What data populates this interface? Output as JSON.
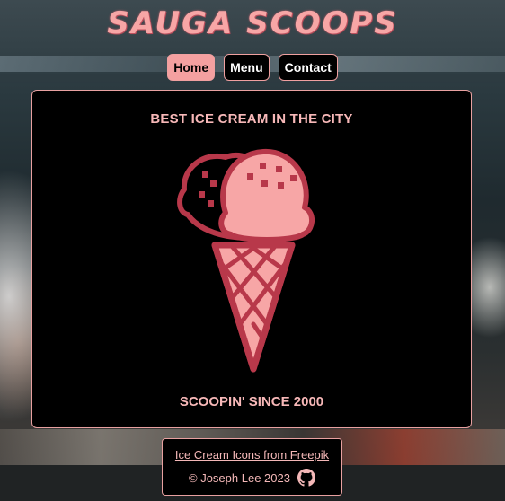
{
  "site": {
    "logo": "SAUGA SCOOPS"
  },
  "nav": {
    "items": [
      {
        "label": "Home",
        "active": true
      },
      {
        "label": "Menu",
        "active": false
      },
      {
        "label": "Contact",
        "active": false
      }
    ]
  },
  "hero": {
    "headline": "BEST ICE CREAM IN THE CITY",
    "tagline": "SCOOPIN' SINCE 2000",
    "image_icon": "ice-cream-cone-icon"
  },
  "footer": {
    "credit_link": "Ice Cream Icons from Freepik",
    "copyright": "© Joseph Lee 2023",
    "social_icon": "github-icon"
  },
  "colors": {
    "accent": "#f4a0a0",
    "cone": "#b8384a",
    "scoop": "#f7a6a6",
    "panel": "#000000"
  }
}
